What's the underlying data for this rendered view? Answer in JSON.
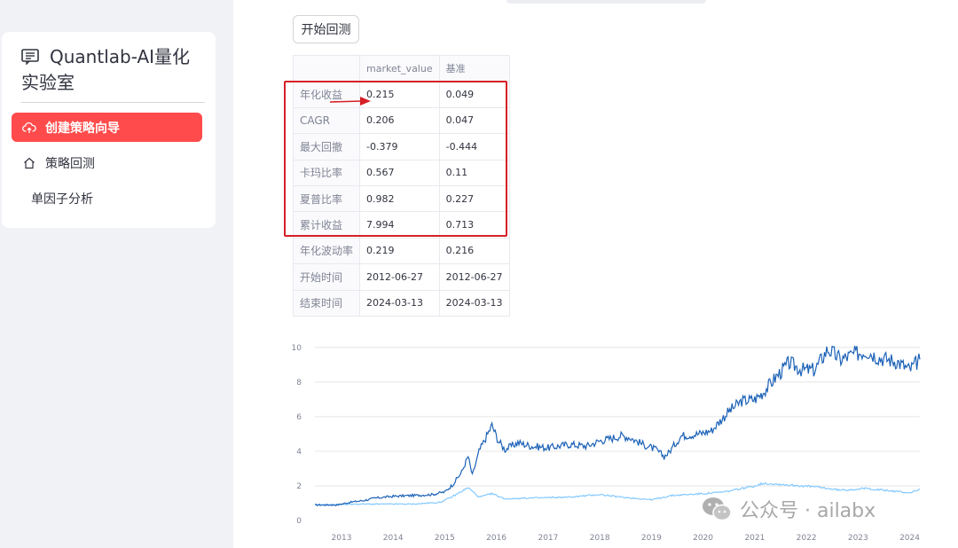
{
  "sidebar": {
    "title": "Quantlab-AI量化实验室",
    "items": [
      {
        "label": "创建策略向导",
        "icon": "cloud-upload-icon",
        "active": true
      },
      {
        "label": "策略回测",
        "icon": "home-icon",
        "active": false
      },
      {
        "label": "单因子分析",
        "icon": "",
        "active": false
      }
    ]
  },
  "main": {
    "run_button": "开始回测",
    "table": {
      "columns": [
        "",
        "market_value",
        "基准"
      ],
      "rows": [
        {
          "label": "年化收益",
          "market_value": "0.215",
          "benchmark": "0.049"
        },
        {
          "label": "CAGR",
          "market_value": "0.206",
          "benchmark": "0.047"
        },
        {
          "label": "最大回撤",
          "market_value": "-0.379",
          "benchmark": "-0.444"
        },
        {
          "label": "卡玛比率",
          "market_value": "0.567",
          "benchmark": "0.11"
        },
        {
          "label": "夏普比率",
          "market_value": "0.982",
          "benchmark": "0.227"
        },
        {
          "label": "累计收益",
          "market_value": "7.994",
          "benchmark": "0.713"
        },
        {
          "label": "年化波动率",
          "market_value": "0.219",
          "benchmark": "0.216"
        },
        {
          "label": "开始时间",
          "market_value": "2012-06-27",
          "benchmark": "2012-06-27"
        },
        {
          "label": "结束时间",
          "market_value": "2024-03-13",
          "benchmark": "2024-03-13"
        }
      ]
    }
  },
  "chart_data": {
    "type": "line",
    "title": "",
    "xlabel": "",
    "ylabel": "",
    "x_ticks": [
      "2013",
      "2014",
      "2015",
      "2016",
      "2017",
      "2018",
      "2019",
      "2020",
      "2021",
      "2022",
      "2023",
      "2024"
    ],
    "y_ticks": [
      0,
      2,
      4,
      6,
      8,
      10
    ],
    "xlim": [
      "2012-06-27",
      "2024-03-13"
    ],
    "ylim": [
      0,
      10.5
    ],
    "grid": "horizontal",
    "series": [
      {
        "color": "#1c62b7",
        "points": [
          [
            "2012-06-27",
            0.9
          ],
          [
            "2012-12-01",
            0.9
          ],
          [
            "2013-03-01",
            1.05
          ],
          [
            "2013-06-01",
            1.15
          ],
          [
            "2013-09-01",
            1.3
          ],
          [
            "2014-01-01",
            1.4
          ],
          [
            "2014-06-01",
            1.45
          ],
          [
            "2014-10-01",
            1.5
          ],
          [
            "2015-01-01",
            1.65
          ],
          [
            "2015-03-01",
            2.1
          ],
          [
            "2015-05-01",
            2.8
          ],
          [
            "2015-06-15",
            3.7
          ],
          [
            "2015-07-15",
            2.6
          ],
          [
            "2015-09-01",
            4.0
          ],
          [
            "2015-12-01",
            5.5
          ],
          [
            "2016-01-15",
            4.6
          ],
          [
            "2016-03-01",
            4.1
          ],
          [
            "2016-06-01",
            4.5
          ],
          [
            "2016-09-01",
            4.3
          ],
          [
            "2017-01-01",
            4.2
          ],
          [
            "2017-06-01",
            4.4
          ],
          [
            "2017-10-01",
            4.3
          ],
          [
            "2018-01-01",
            4.6
          ],
          [
            "2018-03-01",
            4.7
          ],
          [
            "2018-06-01",
            4.9
          ],
          [
            "2018-08-01",
            4.8
          ],
          [
            "2018-11-01",
            4.4
          ],
          [
            "2019-02-01",
            4.1
          ],
          [
            "2019-04-01",
            3.7
          ],
          [
            "2019-05-01",
            3.9
          ],
          [
            "2019-08-01",
            4.9
          ],
          [
            "2019-12-01",
            5.0
          ],
          [
            "2020-03-01",
            5.2
          ],
          [
            "2020-07-01",
            6.3
          ],
          [
            "2020-10-01",
            6.9
          ],
          [
            "2021-01-01",
            7.0
          ],
          [
            "2021-03-01",
            7.4
          ],
          [
            "2021-06-01",
            8.3
          ],
          [
            "2021-09-01",
            9.1
          ],
          [
            "2021-12-01",
            8.7
          ],
          [
            "2022-03-01",
            8.7
          ],
          [
            "2022-06-01",
            9.9
          ],
          [
            "2022-09-01",
            9.3
          ],
          [
            "2022-12-01",
            9.6
          ],
          [
            "2023-03-01",
            9.8
          ],
          [
            "2023-06-01",
            9.4
          ],
          [
            "2023-10-01",
            9.2
          ],
          [
            "2024-01-01",
            8.7
          ],
          [
            "2024-03-13",
            9.3
          ]
        ]
      },
      {
        "color": "#83c9ff",
        "points": [
          [
            "2012-06-27",
            0.9
          ],
          [
            "2013-06-01",
            0.95
          ],
          [
            "2014-06-01",
            0.95
          ],
          [
            "2014-12-01",
            1.05
          ],
          [
            "2015-03-01",
            1.4
          ],
          [
            "2015-06-15",
            1.9
          ],
          [
            "2015-09-01",
            1.35
          ],
          [
            "2015-12-01",
            1.55
          ],
          [
            "2016-03-01",
            1.25
          ],
          [
            "2016-09-01",
            1.3
          ],
          [
            "2017-06-01",
            1.35
          ],
          [
            "2018-01-01",
            1.5
          ],
          [
            "2018-06-01",
            1.35
          ],
          [
            "2019-01-01",
            1.2
          ],
          [
            "2019-06-01",
            1.45
          ],
          [
            "2020-01-01",
            1.55
          ],
          [
            "2020-06-01",
            1.65
          ],
          [
            "2021-01-01",
            2.0
          ],
          [
            "2021-03-01",
            2.15
          ],
          [
            "2021-09-01",
            2.05
          ],
          [
            "2022-03-01",
            1.95
          ],
          [
            "2022-09-01",
            1.75
          ],
          [
            "2023-03-01",
            1.85
          ],
          [
            "2023-09-01",
            1.7
          ],
          [
            "2024-01-01",
            1.6
          ],
          [
            "2024-03-13",
            1.8
          ]
        ]
      }
    ]
  },
  "watermark": {
    "text": "公众号 · ailabx",
    "icon": "wechat-icon"
  }
}
